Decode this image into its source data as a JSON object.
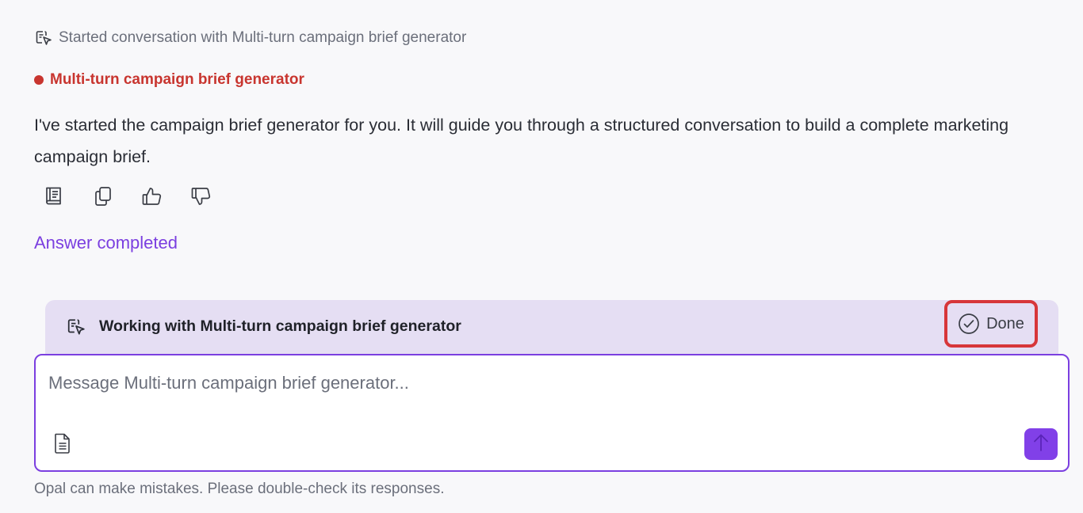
{
  "colors": {
    "accent_red": "#c8352f",
    "accent_purple": "#7b3fe0",
    "accent_purple_button": "#8140e8",
    "working_bar_bg": "#e5def3",
    "highlight_border": "#d7363a"
  },
  "conversation": {
    "started_text": "Started conversation with Multi-turn campaign brief generator",
    "started_icon": "agent-cursor-icon",
    "agent_name": "Multi-turn campaign brief generator",
    "message": "I've started the campaign brief generator for you. It will guide you through a structured conversation to build a complete marketing campaign brief.",
    "actions": [
      {
        "name": "sources",
        "icon": "book-icon"
      },
      {
        "name": "copy",
        "icon": "copy-icon"
      },
      {
        "name": "like",
        "icon": "thumbs-up-icon"
      },
      {
        "name": "dislike",
        "icon": "thumbs-down-icon"
      }
    ],
    "status": "Answer completed"
  },
  "working_bar": {
    "label": "Working with Multi-turn campaign brief generator",
    "icon": "agent-cursor-icon",
    "done_label": "Done",
    "done_icon": "check-circle-icon"
  },
  "composer": {
    "placeholder": "Message Multi-turn campaign brief generator...",
    "value": "",
    "attach_icon": "document-icon",
    "send_icon": "arrow-up-icon"
  },
  "footer": {
    "disclaimer": "Opal can make mistakes. Please double-check its responses."
  }
}
